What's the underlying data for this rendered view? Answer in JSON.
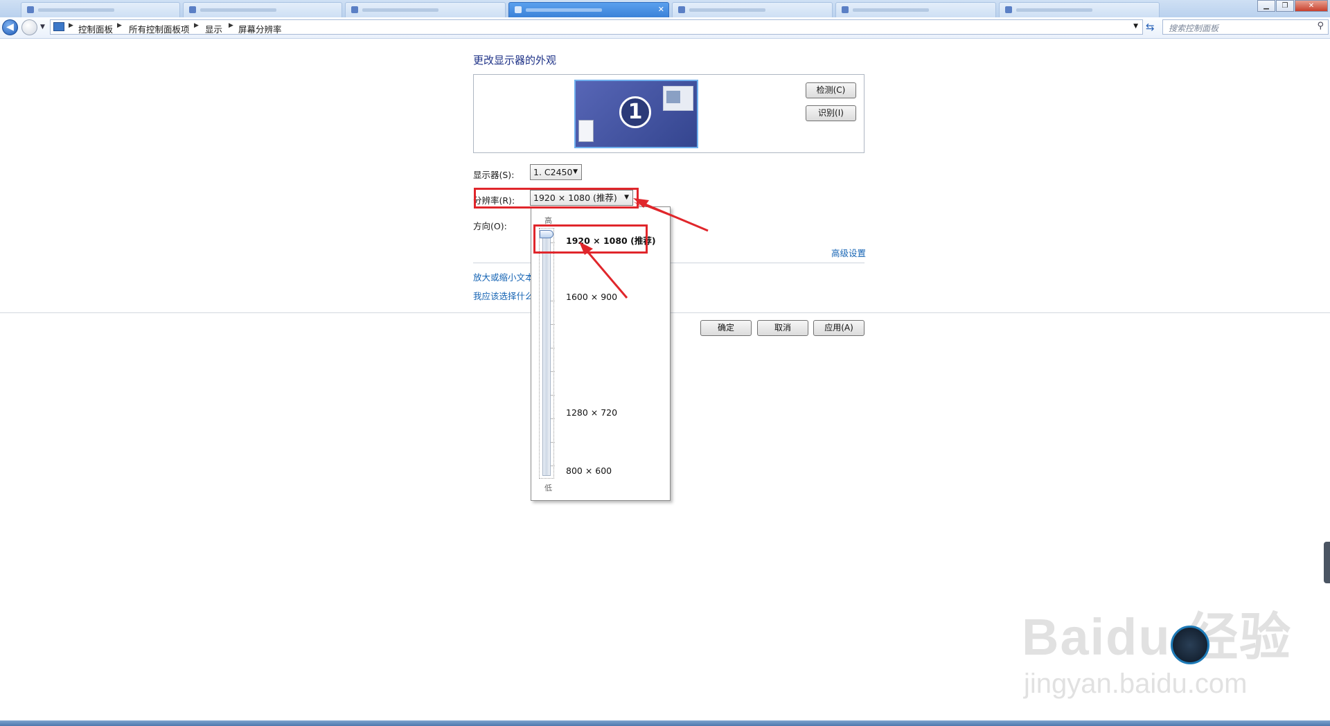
{
  "address_bar": {
    "breadcrumbs": [
      "控制面板",
      "所有控制面板项",
      "显示",
      "屏幕分辨率"
    ],
    "search_placeholder": "搜索控制面板"
  },
  "page": {
    "title": "更改显示器的外观",
    "monitor_number": "1",
    "detect_button": "检测(C)",
    "identify_button": "识别(I)",
    "display_label": "显示器(S):",
    "display_value": "1. C2450",
    "resolution_label": "分辨率(R):",
    "resolution_value": "1920 × 1080 (推荐)",
    "orientation_label": "方向(O):",
    "advanced_link": "高级设置",
    "link_text_size": "放大或缩小文本",
    "link_which_settings": "我应该选择什么",
    "ok_button": "确定",
    "cancel_button": "取消",
    "apply_button": "应用(A)"
  },
  "resolution_dropdown": {
    "high_label": "高",
    "low_label": "低",
    "selected": "1920 × 1080 (推荐)",
    "options": [
      "1600 × 900",
      "1280 × 720",
      "800 × 600"
    ],
    "slider_level": 1.0
  },
  "watermark": {
    "brand": "Baidu 经验",
    "url": "jingyan.baidu.com"
  },
  "colors": {
    "highlight": "#e0262b",
    "link": "#1664b4",
    "title": "#1e3287",
    "monitor": "#3d4f9e"
  }
}
